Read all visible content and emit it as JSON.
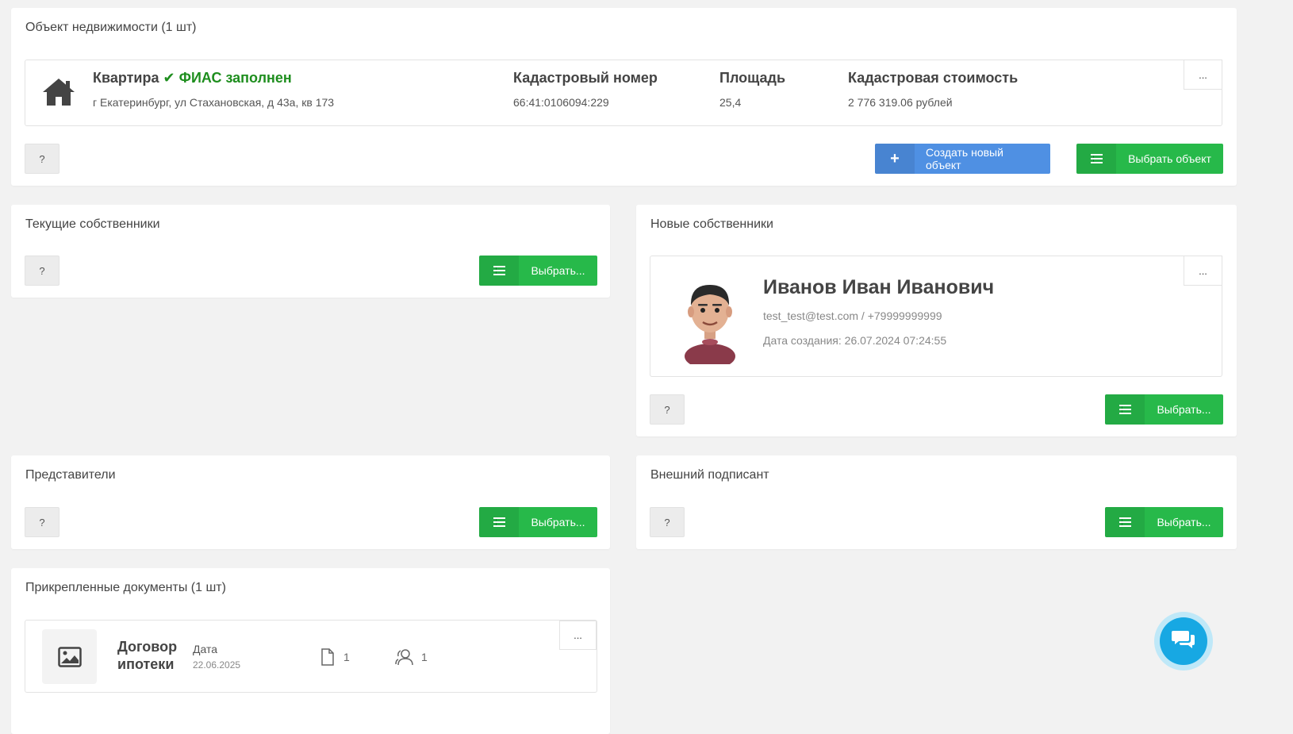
{
  "property": {
    "title": "Объект недвижимости (1 шт)",
    "type": "Квартира",
    "fias_status": "ФИАС заполнен",
    "address": "г Екатеринбург, ул Стахановская, д 43а, кв 173",
    "cadastral_label": "Кадастровый номер",
    "cadastral_value": "66:41:0106094:229",
    "area_label": "Площадь",
    "area_value": "25,4",
    "cost_label": "Кадастровая стоимость",
    "cost_value": "2 776 319.06 рублей",
    "more": "...",
    "help": "?",
    "create_label": "Создать новый объект",
    "select_label": "Выбрать объект"
  },
  "current_owners": {
    "title": "Текущие собственники",
    "help": "?",
    "select_label": "Выбрать..."
  },
  "new_owners": {
    "title": "Новые собственники",
    "help": "?",
    "select_label": "Выбрать...",
    "more": "...",
    "person": {
      "name": "Иванов Иван Иванович",
      "contact": "test_test@test.com / +79999999999",
      "created": "Дата создания: 26.07.2024 07:24:55"
    }
  },
  "representatives": {
    "title": "Представители",
    "help": "?",
    "select_label": "Выбрать..."
  },
  "external_signer": {
    "title": "Внешний подписант",
    "help": "?",
    "select_label": "Выбрать..."
  },
  "documents": {
    "title": "Прикрепленные документы (1 шт)",
    "more": "...",
    "doc": {
      "name_line1": "Договор",
      "name_line2": "ипотеки",
      "date_label": "Дата",
      "date_value": "22.06.2025",
      "files_count": "1",
      "signers_count": "1"
    }
  },
  "colors": {
    "green": "#27b94a",
    "blue": "#4f90e3",
    "chat": "#17a8e3"
  }
}
